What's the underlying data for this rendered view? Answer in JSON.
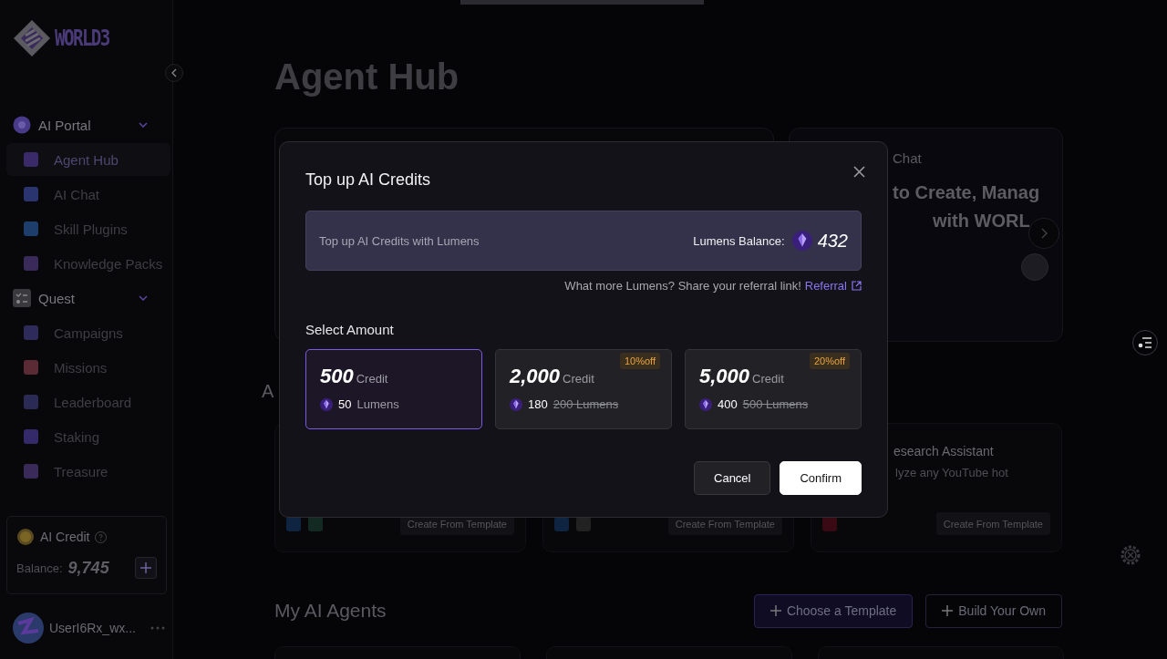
{
  "sidebar": {
    "logo": "WORLD3",
    "sections": [
      {
        "label": "AI Portal",
        "expanded": true,
        "items": [
          {
            "label": "Agent Hub",
            "selected": true
          },
          {
            "label": "AI Chat",
            "selected": false
          },
          {
            "label": "Skill Plugins",
            "selected": false
          },
          {
            "label": "Knowledge Packs",
            "selected": false
          }
        ]
      },
      {
        "label": "Quest",
        "expanded": true,
        "items": [
          {
            "label": "Campaigns",
            "selected": false
          },
          {
            "label": "Missions",
            "selected": false
          },
          {
            "label": "Leaderboard",
            "selected": false
          },
          {
            "label": "Staking",
            "selected": false
          },
          {
            "label": "Treasure",
            "selected": false
          }
        ]
      }
    ],
    "credit": {
      "title": "AI Credit",
      "balance_label": "Balance:",
      "balance": "9,745"
    },
    "user": {
      "name": "UserI6Rx_wx..."
    }
  },
  "main": {
    "title": "Agent Hub",
    "banner": {
      "tag": "Chat",
      "headline": [
        "to Create, Manag",
        "with WORL"
      ]
    },
    "section_fragment": "A",
    "templates": [
      {
        "button": "Create From Template"
      },
      {
        "button": "Create From Template"
      },
      {
        "title": "esearch Assistant",
        "description": "lyze any YouTube hot",
        "button": "Create From Template"
      }
    ],
    "my_agents": {
      "title": "My AI Agents",
      "buttons": [
        {
          "label": "Choose a Template",
          "kind": "primary"
        },
        {
          "label": "Build Your Own",
          "kind": "outline"
        }
      ]
    }
  },
  "modal": {
    "title": "Top up AI Credits",
    "info": {
      "text": "Top up AI Credits with Lumens",
      "balance_label": "Lumens Balance:",
      "balance": "432"
    },
    "referral": {
      "text": "What more Lumens? Share your referral link!",
      "link": "Referral"
    },
    "select_label": "Select Amount",
    "options": [
      {
        "amount": "500",
        "unit": "Credit",
        "price": "50",
        "price_unit": "Lumens",
        "selected": true
      },
      {
        "amount": "2,000",
        "unit": "Credit",
        "price": "180",
        "original": "200 Lumens",
        "discount": "10%off",
        "selected": false
      },
      {
        "amount": "5,000",
        "unit": "Credit",
        "price": "400",
        "original": "500 Lumens",
        "discount": "20%off",
        "selected": false
      }
    ],
    "buttons": [
      {
        "label": "Cancel",
        "kind": "secondary"
      },
      {
        "label": "Confirm",
        "kind": "primary"
      }
    ]
  }
}
